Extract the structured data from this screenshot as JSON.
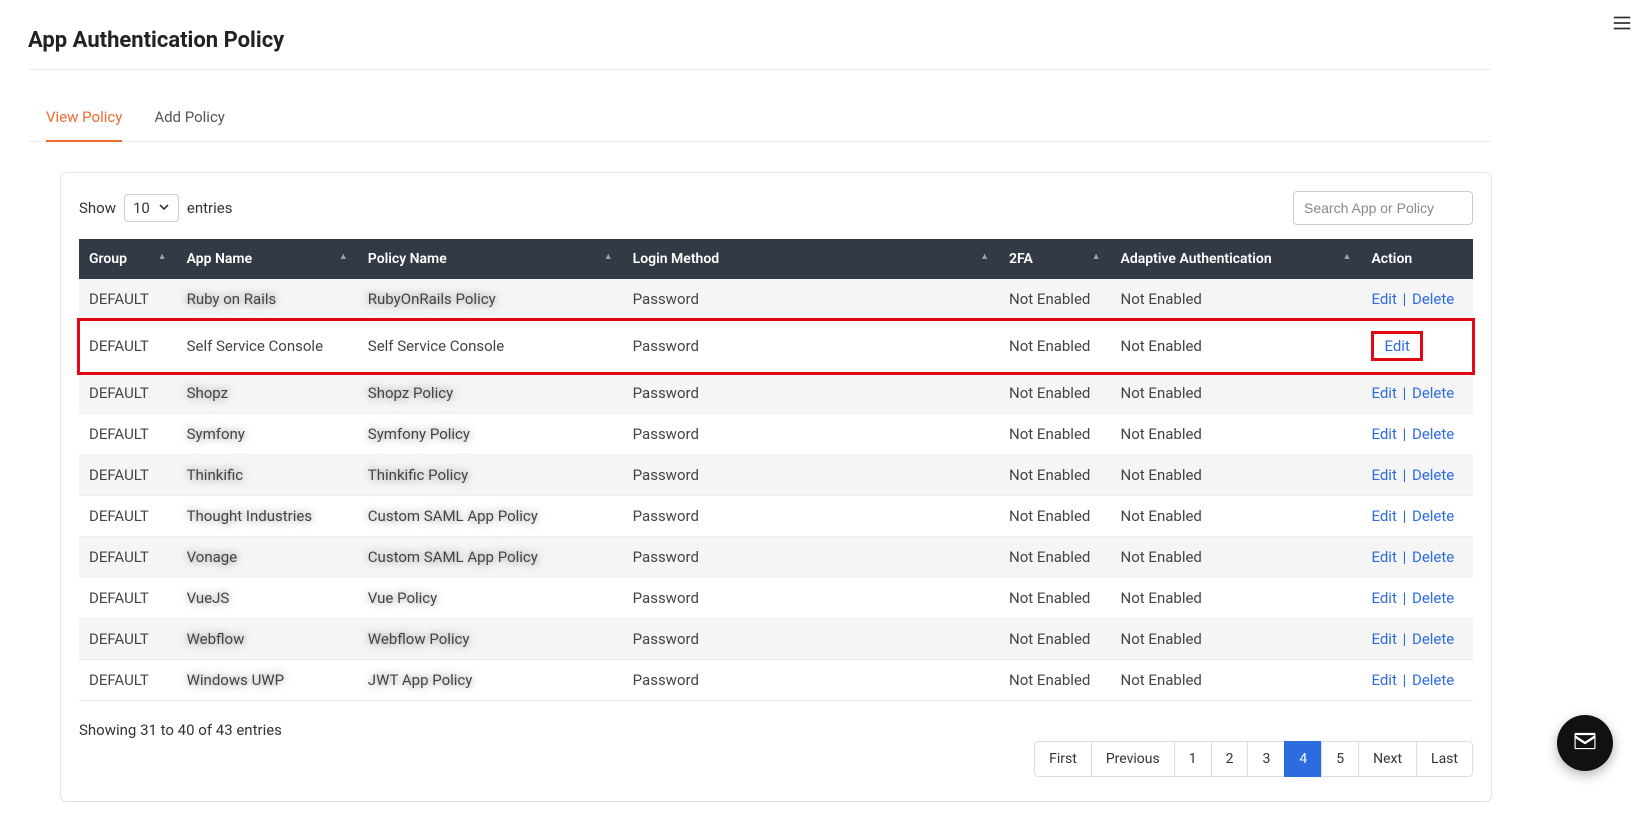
{
  "header": {
    "title": "App Authentication Policy"
  },
  "tabs": {
    "view": "View Policy",
    "add": "Add Policy"
  },
  "toolbar": {
    "show_label": "Show",
    "page_size": "10",
    "entries_label": "entries",
    "search_placeholder": "Search App or Policy"
  },
  "columns": {
    "group": "Group",
    "app": "App Name",
    "policy": "Policy Name",
    "login": "Login Method",
    "twofa": "2FA",
    "adaptive": "Adaptive Authentication",
    "action": "Action"
  },
  "status": {
    "not_enabled": "Not Enabled"
  },
  "actions": {
    "edit": "Edit",
    "delete": "Delete",
    "sep": " | "
  },
  "rows": [
    {
      "group": "DEFAULT",
      "app": "Ruby on Rails",
      "policy": "RubyOnRails Policy",
      "login": "Password",
      "blurred": true,
      "highlighted": false,
      "show_delete": true
    },
    {
      "group": "DEFAULT",
      "app": "Self Service Console",
      "policy": "Self Service Console",
      "login": "Password",
      "blurred": false,
      "highlighted": true,
      "show_delete": false
    },
    {
      "group": "DEFAULT",
      "app": "Shopz",
      "policy": "Shopz Policy",
      "login": "Password",
      "blurred": true,
      "highlighted": false,
      "show_delete": true
    },
    {
      "group": "DEFAULT",
      "app": "Symfony",
      "policy": "Symfony Policy",
      "login": "Password",
      "blurred": true,
      "highlighted": false,
      "show_delete": true
    },
    {
      "group": "DEFAULT",
      "app": "Thinkific",
      "policy": "Thinkific Policy",
      "login": "Password",
      "blurred": true,
      "highlighted": false,
      "show_delete": true
    },
    {
      "group": "DEFAULT",
      "app": "Thought Industries",
      "policy": "Custom SAML App Policy",
      "login": "Password",
      "blurred": true,
      "highlighted": false,
      "show_delete": true
    },
    {
      "group": "DEFAULT",
      "app": "Vonage",
      "policy": "Custom SAML App Policy",
      "login": "Password",
      "blurred": true,
      "highlighted": false,
      "show_delete": true
    },
    {
      "group": "DEFAULT",
      "app": "VueJS",
      "policy": "Vue Policy",
      "login": "Password",
      "blurred": true,
      "highlighted": false,
      "show_delete": true
    },
    {
      "group": "DEFAULT",
      "app": "Webflow",
      "policy": "Webflow Policy",
      "login": "Password",
      "blurred": true,
      "highlighted": false,
      "show_delete": true
    },
    {
      "group": "DEFAULT",
      "app": "Windows UWP",
      "policy": "JWT App Policy",
      "login": "Password",
      "blurred": true,
      "highlighted": false,
      "show_delete": true
    }
  ],
  "footer": {
    "info": "Showing 31 to 40 of 43 entries"
  },
  "pagination": {
    "first": "First",
    "previous": "Previous",
    "pages": [
      "1",
      "2",
      "3",
      "4",
      "5"
    ],
    "active": "4",
    "next": "Next",
    "last": "Last"
  }
}
